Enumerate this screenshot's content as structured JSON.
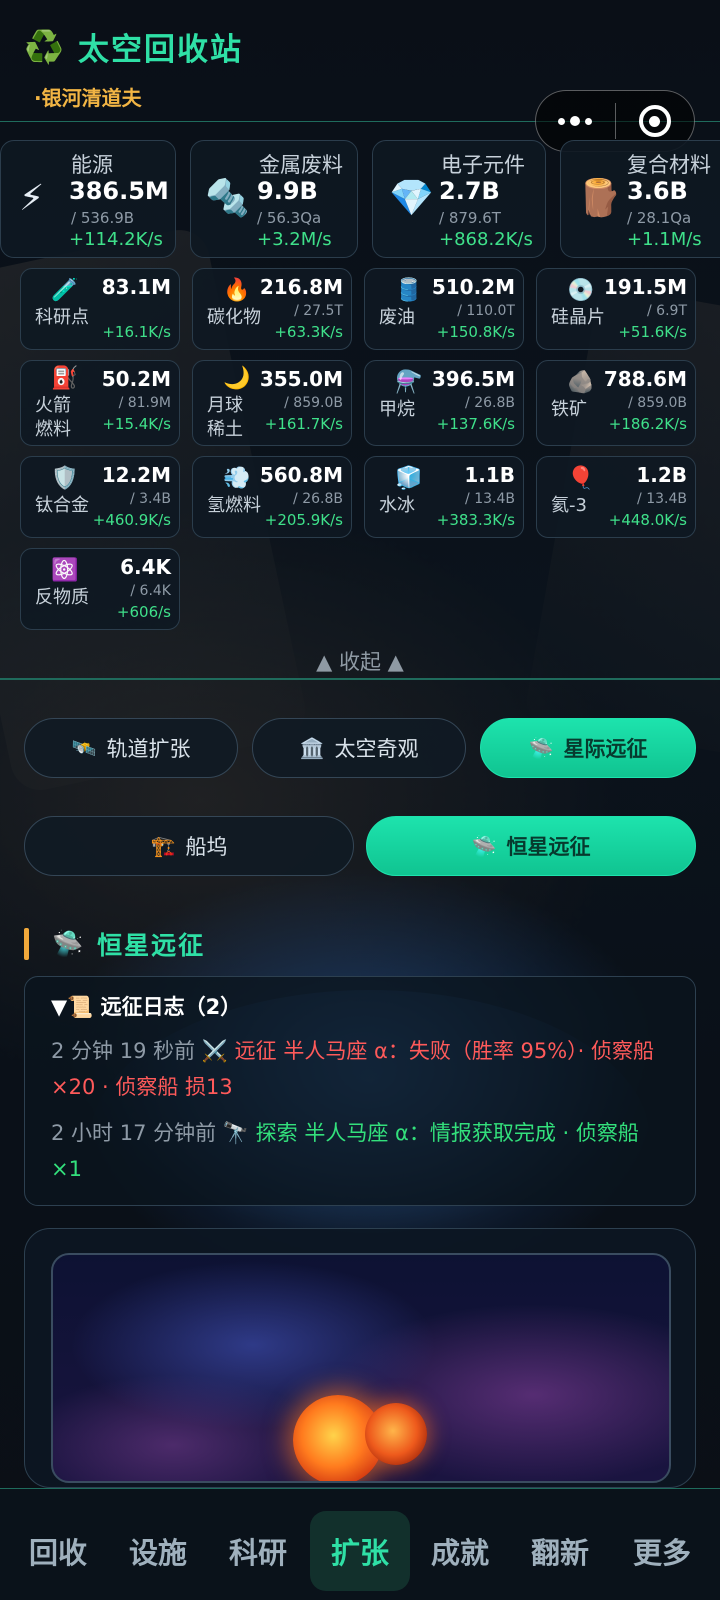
{
  "header": {
    "title": "太空回收站",
    "subtitle": "·银河清道夫",
    "recycle_icon": "♻️"
  },
  "main_resources": [
    {
      "name": "能源",
      "icon": "⚡",
      "amount": "386.5M",
      "cap": "/ 536.9B",
      "rate": "+114.2K/s"
    },
    {
      "name": "金属废料",
      "icon": "🔩",
      "amount": "9.9B",
      "cap": "/ 56.3Qa",
      "rate": "+3.2M/s"
    },
    {
      "name": "电子元件",
      "icon": "💎",
      "amount": "2.7B",
      "cap": "/ 879.6T",
      "rate": "+868.2K/s"
    },
    {
      "name": "复合材料",
      "icon": "🪵",
      "amount": "3.6B",
      "cap": "/ 28.1Qa",
      "rate": "+1.1M/s"
    }
  ],
  "sub_resources": [
    {
      "name": "科研点",
      "icon": "🧪",
      "amount": "83.1M",
      "cap": "",
      "rate": "+16.1K/s"
    },
    {
      "name": "碳化物",
      "icon": "🔥",
      "amount": "216.8M",
      "cap": "/ 27.5T",
      "rate": "+63.3K/s"
    },
    {
      "name": "废油",
      "icon": "🛢️",
      "amount": "510.2M",
      "cap": "/ 110.0T",
      "rate": "+150.8K/s"
    },
    {
      "name": "硅晶片",
      "icon": "💿",
      "amount": "191.5M",
      "cap": "/ 6.9T",
      "rate": "+51.6K/s"
    },
    {
      "name1": "火箭",
      "name2": "燃料",
      "icon": "⛽",
      "amount": "50.2M",
      "cap": "/ 81.9M",
      "rate": "+15.4K/s"
    },
    {
      "name1": "月球",
      "name2": "稀土",
      "icon": "🌙",
      "amount": "355.0M",
      "cap": "/ 859.0B",
      "rate": "+161.7K/s"
    },
    {
      "name": "甲烷",
      "icon": "⚗️",
      "amount": "396.5M",
      "cap": "/ 26.8B",
      "rate": "+137.6K/s"
    },
    {
      "name": "铁矿",
      "icon": "🪨",
      "amount": "788.6M",
      "cap": "/ 859.0B",
      "rate": "+186.2K/s"
    },
    {
      "name": "钛合金",
      "icon": "🛡️",
      "amount": "12.2M",
      "cap": "/ 3.4B",
      "rate": "+460.9K/s"
    },
    {
      "name": "氢燃料",
      "icon": "💨",
      "amount": "560.8M",
      "cap": "/ 26.8B",
      "rate": "+205.9K/s"
    },
    {
      "name": "水冰",
      "icon": "🧊",
      "amount": "1.1B",
      "cap": "/ 13.4B",
      "rate": "+383.3K/s"
    },
    {
      "name": "氦-3",
      "icon": "🎈",
      "amount": "1.2B",
      "cap": "/ 13.4B",
      "rate": "+448.0K/s"
    },
    {
      "name": "反物质",
      "icon": "⚛️",
      "amount": "6.4K",
      "cap": "/ 6.4K",
      "rate": "+606/s"
    }
  ],
  "collapse_label": "▲ 收起 ▲",
  "main_tabs": [
    {
      "label": "轨道扩张",
      "icon": "🛰️",
      "active": false
    },
    {
      "label": "太空奇观",
      "icon": "🏛️",
      "active": false
    },
    {
      "label": "星际远征",
      "icon": "🛸",
      "active": true
    }
  ],
  "sub_tabs": [
    {
      "label": "船坞",
      "icon": "🏗️",
      "active": false
    },
    {
      "label": "恒星远征",
      "icon": "🛸",
      "active": true
    }
  ],
  "section": {
    "icon": "🛸",
    "title": "恒星远征"
  },
  "log": {
    "title": "▼📜 远征日志（2）",
    "entries": [
      {
        "status": "fail",
        "time": "2 分钟 19 秒前",
        "icon": "⚔️",
        "msg": "远征 半人马座 α：失败（胜率 95%）· 侦察船×20 · 侦察船 损13"
      },
      {
        "status": "ok",
        "time": "2 小时 17 分钟前",
        "icon": "🔭",
        "msg": "探索 半人马座 α：情报获取完成 · 侦察船×1"
      }
    ]
  },
  "bottom_nav": [
    {
      "label": "回收",
      "active": false
    },
    {
      "label": "设施",
      "active": false
    },
    {
      "label": "科研",
      "active": false
    },
    {
      "label": "扩张",
      "active": true
    },
    {
      "label": "成就",
      "active": false
    },
    {
      "label": "翻新",
      "active": false
    },
    {
      "label": "更多",
      "active": false
    }
  ],
  "colors": {
    "accent": "#2fe0a6",
    "gold": "#f2b544",
    "rate_green": "#3fe08a",
    "fail_red": "#ff5a5a"
  }
}
